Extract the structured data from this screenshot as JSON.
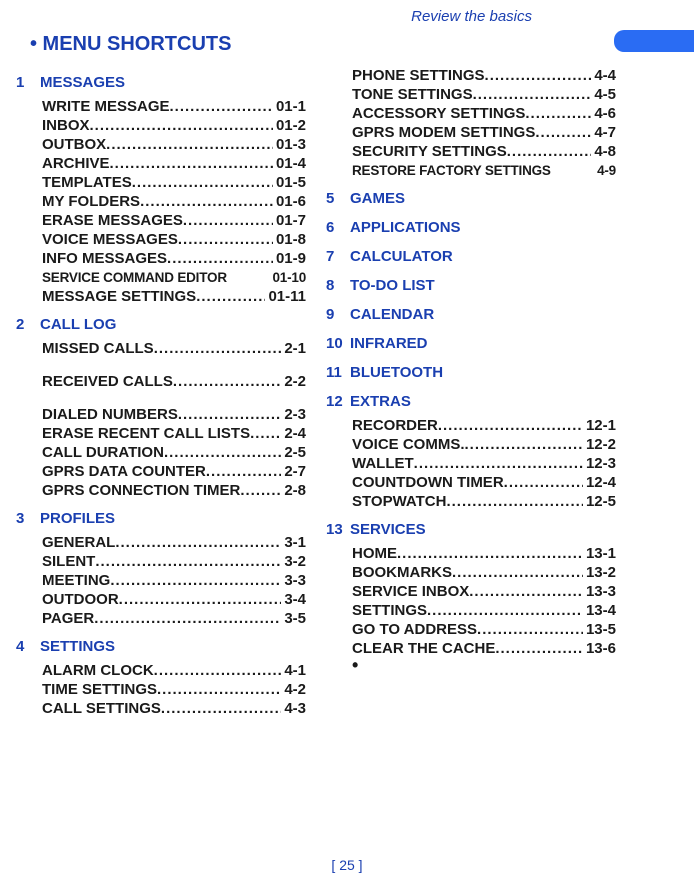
{
  "header": "Review the basics",
  "mainHeading": "• MENU SHORTCUTS",
  "footer": "[ 25 ]",
  "sections": [
    {
      "num": "1",
      "name": "MESSAGES",
      "col": "left",
      "items": [
        {
          "label": "WRITE MESSAGE",
          "code": "01-1"
        },
        {
          "label": "INBOX",
          "code": "01-2"
        },
        {
          "label": "OUTBOX",
          "code": "01-3"
        },
        {
          "label": "ARCHIVE",
          "code": "01-4"
        },
        {
          "label": "TEMPLATES",
          "code": "01-5"
        },
        {
          "label": "MY FOLDERS",
          "code": "01-6"
        },
        {
          "label": "ERASE MESSAGES",
          "code": "01-7"
        },
        {
          "label": "VOICE MESSAGES",
          "code": "01-8"
        },
        {
          "label": "INFO MESSAGES",
          "code": "01-9"
        },
        {
          "label": "SERVICE COMMAND EDITOR",
          "code": "01-10",
          "small": true,
          "nodots": true
        },
        {
          "label": "MESSAGE SETTINGS",
          "code": "01-11"
        }
      ]
    },
    {
      "num": "2",
      "name": "CALL LOG",
      "col": "left",
      "items": [
        {
          "label": "MISSED CALLS",
          "code": "2-1",
          "gapAfter": true
        },
        {
          "label": "RECEIVED CALLS",
          "code": "2-2",
          "gapAfter": true
        },
        {
          "label": "DIALED NUMBERS",
          "code": "2-3"
        },
        {
          "label": "ERASE RECENT CALL LISTS",
          "code": "2-4"
        },
        {
          "label": "CALL DURATION",
          "code": "2-5"
        },
        {
          "label": "GPRS DATA COUNTER",
          "code": "2-7"
        },
        {
          "label": "GPRS CONNECTION TIMER",
          "code": "2-8"
        }
      ]
    },
    {
      "num": "3",
      "name": "PROFILES",
      "col": "left",
      "items": [
        {
          "label": "GENERAL",
          "code": "3-1"
        },
        {
          "label": "SILENT",
          "code": "3-2"
        },
        {
          "label": "MEETING",
          "code": "3-3"
        },
        {
          "label": "OUTDOOR",
          "code": "3-4"
        },
        {
          "label": "PAGER",
          "code": "3-5"
        }
      ]
    },
    {
      "num": "4",
      "name": "SETTINGS",
      "col": "left",
      "items": [
        {
          "label": "ALARM CLOCK",
          "code": "4-1"
        },
        {
          "label": "TIME SETTINGS",
          "code": "4-2"
        },
        {
          "label": "CALL SETTINGS",
          "code": "4-3"
        }
      ]
    },
    {
      "num": "",
      "name": "",
      "col": "right",
      "continuation": true,
      "items": [
        {
          "label": "PHONE SETTINGS",
          "code": "4-4"
        },
        {
          "label": "TONE SETTINGS",
          "code": "4-5"
        },
        {
          "label": "ACCESSORY SETTINGS",
          "code": "4-6"
        },
        {
          "label": "GPRS MODEM SETTINGS",
          "code": "4-7"
        },
        {
          "label": "SECURITY SETTINGS",
          "code": "4-8"
        },
        {
          "label": "RESTORE FACTORY SETTINGS",
          "code": "4-9",
          "small": true,
          "nodots": true
        }
      ]
    },
    {
      "num": "5",
      "name": "GAMES",
      "col": "right",
      "items": []
    },
    {
      "num": "6",
      "name": "APPLICATIONS",
      "col": "right",
      "items": []
    },
    {
      "num": "7",
      "name": "CALCULATOR",
      "col": "right",
      "items": []
    },
    {
      "num": "8",
      "name": "TO-DO LIST",
      "col": "right",
      "items": []
    },
    {
      "num": "9",
      "name": "CALENDAR",
      "col": "right",
      "items": []
    },
    {
      "num": "10",
      "name": "INFRARED",
      "col": "right",
      "items": []
    },
    {
      "num": "11",
      "name": "BLUETOOTH",
      "col": "right",
      "items": []
    },
    {
      "num": "12",
      "name": "EXTRAS",
      "col": "right",
      "items": [
        {
          "label": "RECORDER",
          "code": "12-1"
        },
        {
          "label": "VOICE COMMS.",
          "code": "12-2"
        },
        {
          "label": "WALLET",
          "code": "12-3"
        },
        {
          "label": "COUNTDOWN TIMER",
          "code": "12-4"
        },
        {
          "label": "STOPWATCH",
          "code": "12-5"
        }
      ]
    },
    {
      "num": "13",
      "name": "SERVICES",
      "col": "right",
      "items": [
        {
          "label": "HOME",
          "code": "13-1"
        },
        {
          "label": "BOOKMARKS",
          "code": "13-2"
        },
        {
          "label": "SERVICE INBOX",
          "code": "13-3"
        },
        {
          "label": "SETTINGS",
          "code": "13-4"
        },
        {
          "label": "GO TO ADDRESS",
          "code": "13-5"
        },
        {
          "label": "CLEAR THE CACHE",
          "code": "13-6"
        }
      ],
      "endBullet": "•"
    }
  ]
}
